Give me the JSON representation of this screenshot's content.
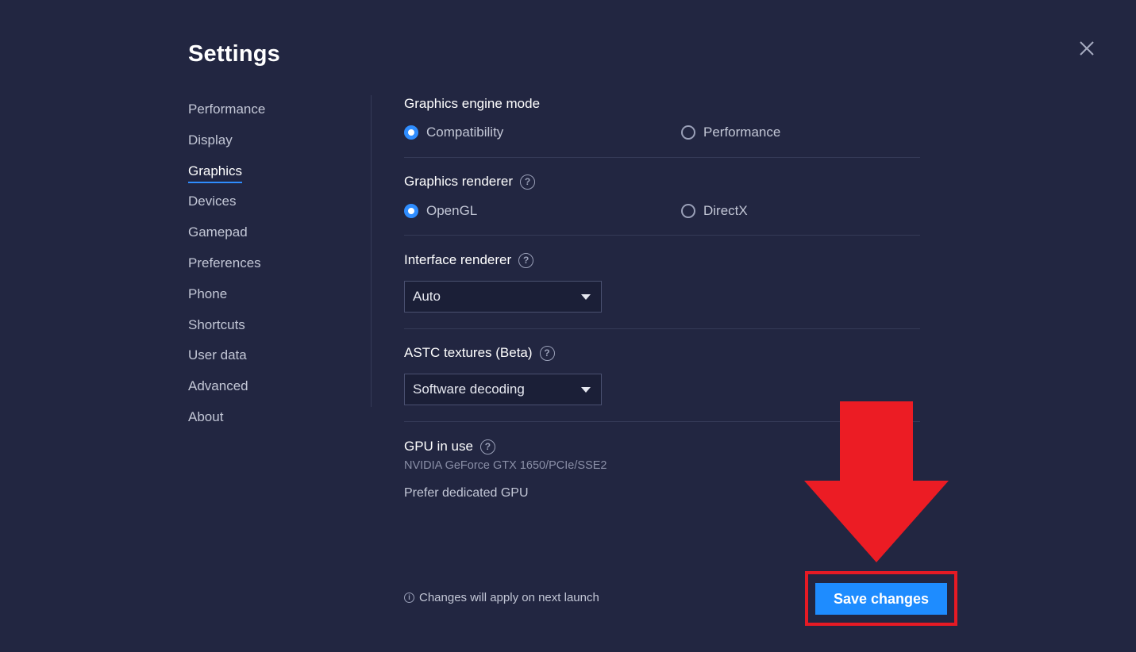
{
  "header": {
    "title": "Settings"
  },
  "sidebar": {
    "items": [
      {
        "label": "Performance"
      },
      {
        "label": "Display"
      },
      {
        "label": "Graphics",
        "active": true
      },
      {
        "label": "Devices"
      },
      {
        "label": "Gamepad"
      },
      {
        "label": "Preferences"
      },
      {
        "label": "Phone"
      },
      {
        "label": "Shortcuts"
      },
      {
        "label": "User data"
      },
      {
        "label": "Advanced"
      },
      {
        "label": "About"
      }
    ]
  },
  "graphics": {
    "engine_mode": {
      "label": "Graphics engine mode",
      "options": [
        {
          "label": "Compatibility",
          "selected": true
        },
        {
          "label": "Performance",
          "selected": false
        }
      ]
    },
    "renderer": {
      "label": "Graphics renderer",
      "options": [
        {
          "label": "OpenGL",
          "selected": true
        },
        {
          "label": "DirectX",
          "selected": false
        }
      ]
    },
    "interface_renderer": {
      "label": "Interface renderer",
      "value": "Auto"
    },
    "astc": {
      "label": "ASTC textures (Beta)",
      "value": "Software decoding"
    },
    "gpu": {
      "label": "GPU in use",
      "name": "NVIDIA GeForce GTX 1650/PCIe/SSE2",
      "prefer_label": "Prefer dedicated GPU"
    }
  },
  "footer": {
    "note": "Changes will apply on next launch",
    "save_label": "Save changes"
  },
  "icons": {
    "close": "close-icon",
    "help": "question-circle-icon",
    "info": "info-icon",
    "dropdown": "chevron-down-icon",
    "annotation_arrow": "arrow-down-icon"
  },
  "colors": {
    "background": "#222641",
    "accent": "#1e8cff",
    "annotation": "#e51a24"
  }
}
